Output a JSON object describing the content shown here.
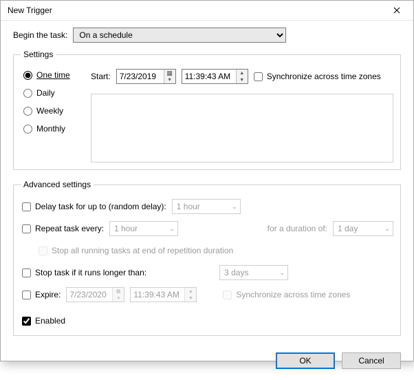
{
  "window": {
    "title": "New Trigger"
  },
  "begin_task": {
    "label": "Begin the task:",
    "value": "On a schedule"
  },
  "settings": {
    "legend": "Settings",
    "frequency": {
      "one_time": "One time",
      "daily": "Daily",
      "weekly": "Weekly",
      "monthly": "Monthly",
      "selected": "one_time"
    },
    "start_label": "Start:",
    "start_date": "7/23/2019",
    "start_time": "11:39:43 AM",
    "sync_tz_label": "Synchronize across time zones",
    "sync_tz_checked": false
  },
  "advanced": {
    "legend": "Advanced settings",
    "delay": {
      "label": "Delay task for up to (random delay):",
      "checked": false,
      "value": "1 hour"
    },
    "repeat": {
      "label": "Repeat task every:",
      "checked": false,
      "interval": "1 hour",
      "duration_label": "for a duration of:",
      "duration": "1 day"
    },
    "stop_at_end": {
      "label": "Stop all running tasks at end of repetition duration",
      "checked": false
    },
    "stop_if_longer": {
      "label": "Stop task if it runs longer than:",
      "checked": false,
      "value": "3 days"
    },
    "expire": {
      "label": "Expire:",
      "checked": false,
      "date": "7/23/2020",
      "time": "11:39:43 AM",
      "sync_tz_label": "Synchronize across time zones",
      "sync_tz_checked": false
    },
    "enabled": {
      "label": "Enabled",
      "checked": true
    }
  },
  "buttons": {
    "ok": "OK",
    "cancel": "Cancel"
  }
}
